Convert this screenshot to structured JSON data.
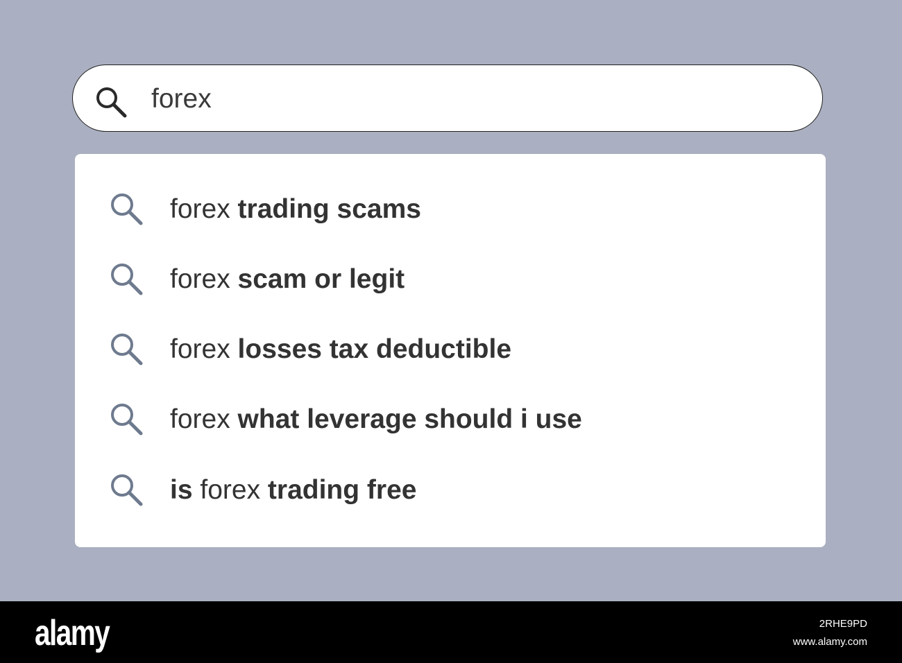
{
  "search": {
    "query": "forex"
  },
  "suggestions": [
    {
      "parts": [
        {
          "text": "forex ",
          "bold": false
        },
        {
          "text": "trading scams",
          "bold": true
        }
      ]
    },
    {
      "parts": [
        {
          "text": "forex ",
          "bold": false
        },
        {
          "text": "scam or legit",
          "bold": true
        }
      ]
    },
    {
      "parts": [
        {
          "text": "forex ",
          "bold": false
        },
        {
          "text": "losses tax deductible",
          "bold": true
        }
      ]
    },
    {
      "parts": [
        {
          "text": "forex ",
          "bold": false
        },
        {
          "text": "what leverage should i use",
          "bold": true
        }
      ]
    },
    {
      "parts": [
        {
          "text": "is",
          "bold": true
        },
        {
          "text": " forex ",
          "bold": false
        },
        {
          "text": "trading free",
          "bold": true
        }
      ]
    }
  ],
  "footer": {
    "brand": "alamy",
    "image_id": "2RHE9PD",
    "site": "www.alamy.com"
  },
  "icons": {
    "search_bar": "search-icon",
    "suggestion": "search-icon"
  },
  "colors": {
    "background": "#aab0c1",
    "suggestion_icon": "#6e7a8e",
    "bar_icon": "#2a2a2a"
  }
}
